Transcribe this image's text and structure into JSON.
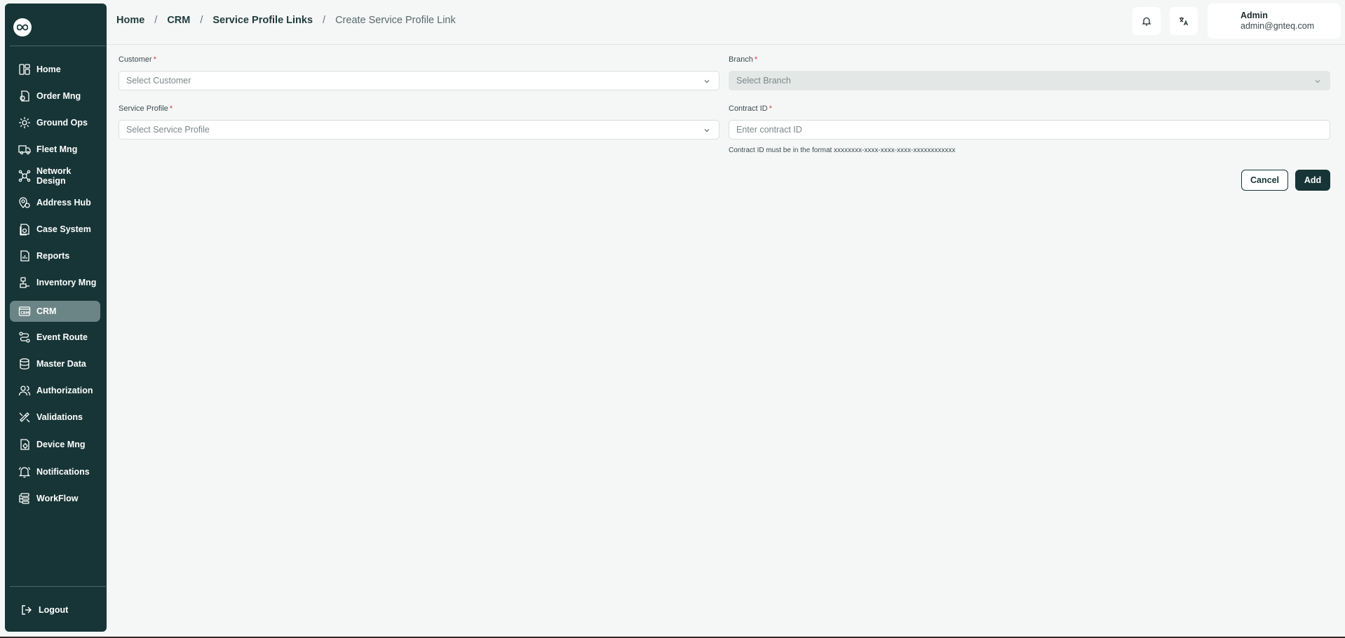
{
  "sidebar": {
    "items": [
      {
        "label": "Home",
        "icon": "home-icon"
      },
      {
        "label": "Order Mng",
        "icon": "order-icon"
      },
      {
        "label": "Ground Ops",
        "icon": "ground-ops-icon"
      },
      {
        "label": "Fleet Mng",
        "icon": "truck-icon"
      },
      {
        "label": "Network Design",
        "icon": "network-icon"
      },
      {
        "label": "Address Hub",
        "icon": "map-pin-icon"
      },
      {
        "label": "Case System",
        "icon": "case-icon"
      },
      {
        "label": "Reports",
        "icon": "report-icon"
      },
      {
        "label": "Inventory Mng",
        "icon": "inventory-icon"
      },
      {
        "label": "CRM",
        "icon": "crm-icon",
        "active": true
      },
      {
        "label": "Event Route",
        "icon": "route-icon"
      },
      {
        "label": "Master Data",
        "icon": "database-icon"
      },
      {
        "label": "Authorization",
        "icon": "users-icon"
      },
      {
        "label": "Validations",
        "icon": "validation-icon"
      },
      {
        "label": "Device Mng",
        "icon": "device-icon"
      },
      {
        "label": "Notifications",
        "icon": "bell-icon"
      },
      {
        "label": "WorkFlow",
        "icon": "workflow-icon"
      }
    ],
    "logout_label": "Logout"
  },
  "breadcrumb": {
    "items": [
      "Home",
      "CRM",
      "Service Profile Links"
    ],
    "separator": "/",
    "current": "Create Service Profile Link"
  },
  "header": {
    "notification_icon": "bell-icon",
    "language_icon": "translate-icon",
    "user": {
      "name": "Admin",
      "email": "admin@gnteq.com"
    }
  },
  "form": {
    "customer": {
      "label": "Customer",
      "required": "*",
      "placeholder": "Select Customer"
    },
    "branch": {
      "label": "Branch",
      "required": "*",
      "placeholder": "Select Branch"
    },
    "service_profile": {
      "label": "Service Profile",
      "required": "*",
      "placeholder": "Select Service Profile"
    },
    "contract_id": {
      "label": "Contract ID",
      "required": "*",
      "placeholder": "Enter contract ID",
      "value": "",
      "helper": "Contract ID must be in the format xxxxxxxx-xxxx-xxxx-xxxx-xxxxxxxxxxxx"
    },
    "cancel_label": "Cancel",
    "add_label": "Add"
  },
  "colors": {
    "sidebar_bg": "#173536",
    "active_item": "#6b8485",
    "accent": "#173536",
    "required": "#d9363e"
  }
}
